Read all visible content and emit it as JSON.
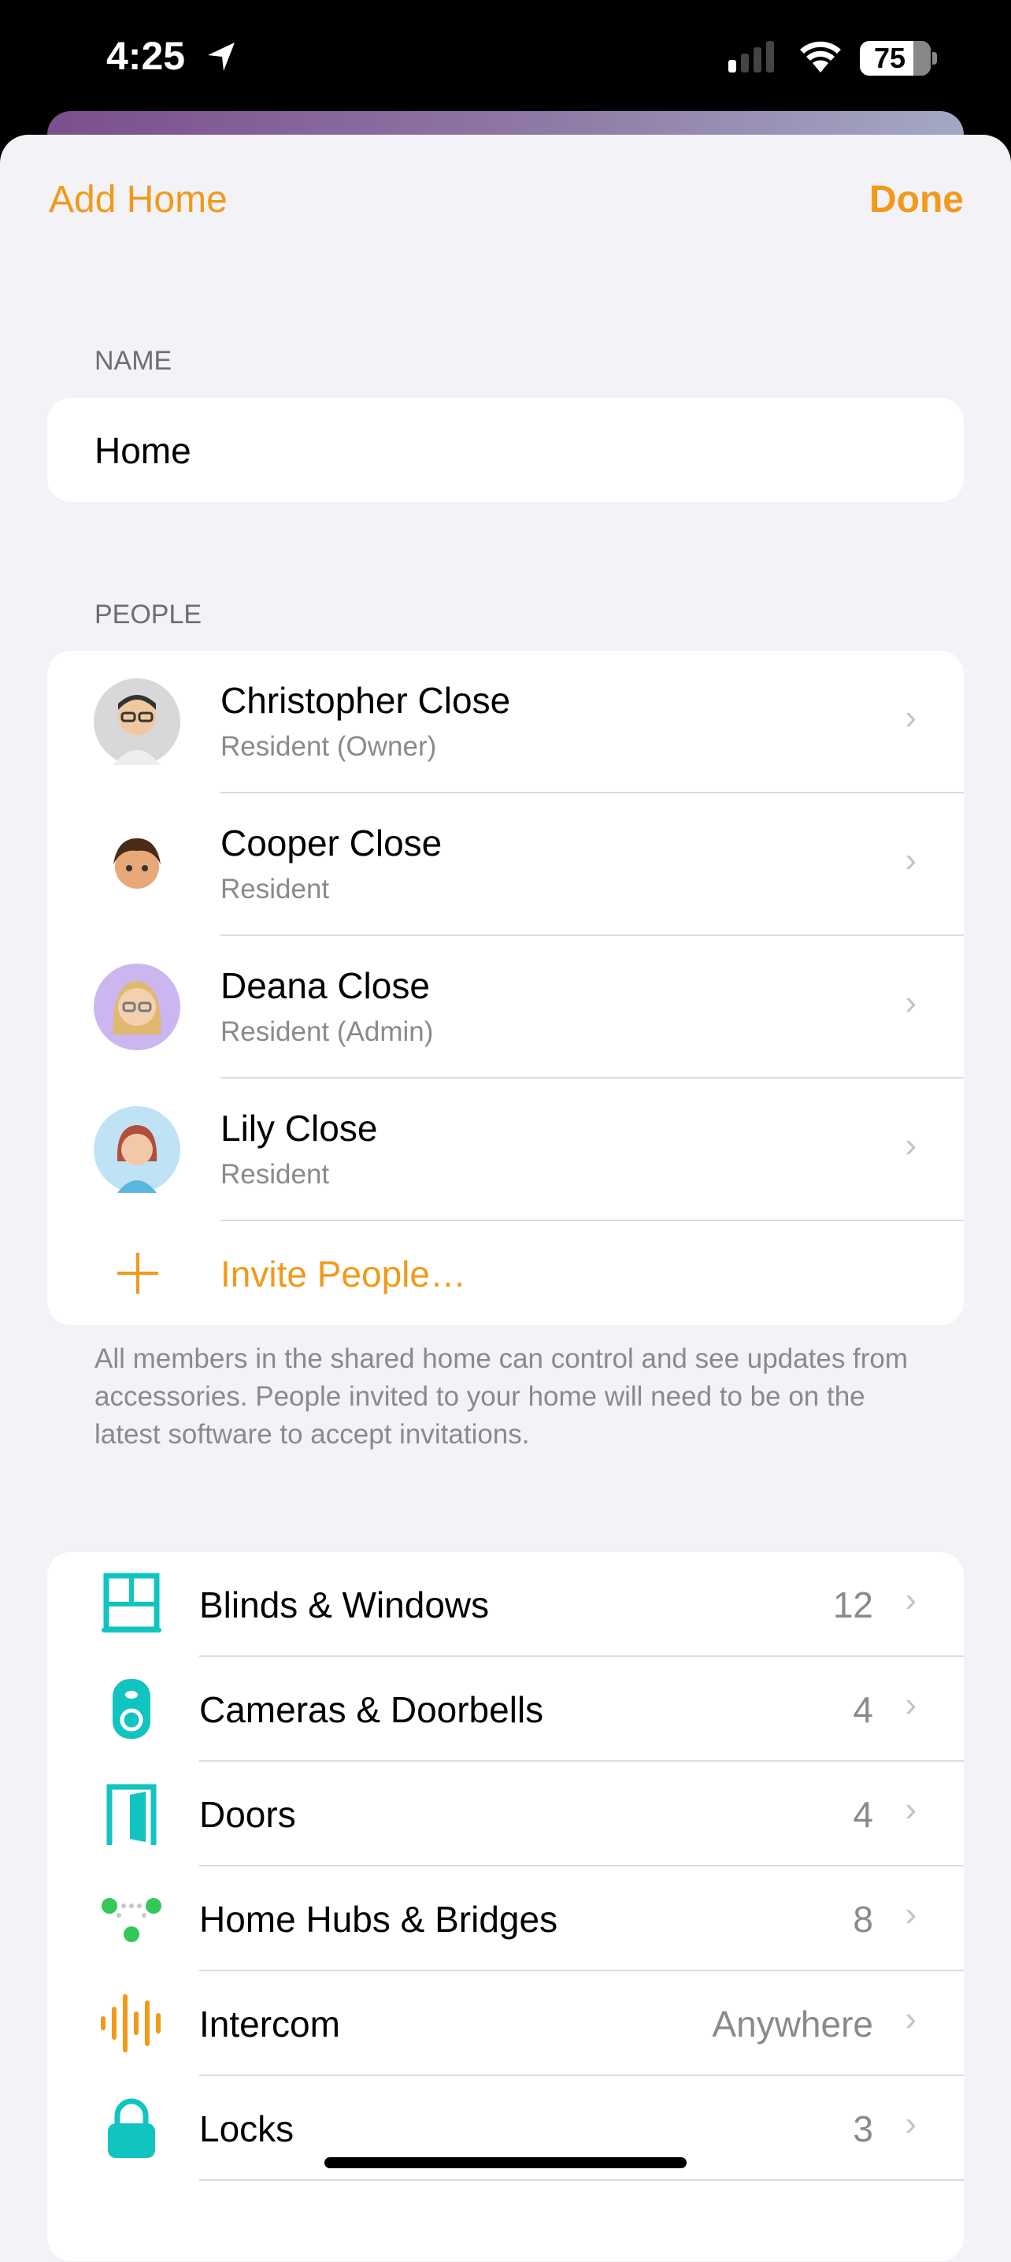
{
  "status_bar": {
    "time": "4:25",
    "battery": "75",
    "signal_bars": 1
  },
  "nav": {
    "left": "Add Home",
    "right": "Done"
  },
  "name_section": {
    "label": "NAME",
    "value": "Home"
  },
  "people_section": {
    "label": "PEOPLE",
    "people": [
      {
        "name": "Christopher Close",
        "role": "Resident (Owner)",
        "avatar_color": "#d8d8d8"
      },
      {
        "name": "Cooper Close",
        "role": "Resident",
        "avatar_color": "#ffffff"
      },
      {
        "name": "Deana Close",
        "role": "Resident (Admin)",
        "avatar_color": "#cbb6f0"
      },
      {
        "name": "Lily Close",
        "role": "Resident",
        "avatar_color": "#bfe3f5"
      }
    ],
    "invite": "Invite People…",
    "footer": "All members in the shared home can control and see updates from accessories. People invited to your home will need to be on the latest software to accept invitations."
  },
  "categories": [
    {
      "name": "Blinds & Windows",
      "value": "12",
      "icon": "window-blinds-icon"
    },
    {
      "name": "Cameras & Doorbells",
      "value": "4",
      "icon": "camera-doorbell-icon"
    },
    {
      "name": "Doors",
      "value": "4",
      "icon": "door-icon"
    },
    {
      "name": "Home Hubs & Bridges",
      "value": "8",
      "icon": "home-hub-icon"
    },
    {
      "name": "Intercom",
      "value": "Anywhere",
      "icon": "intercom-waveform-icon"
    },
    {
      "name": "Locks",
      "value": "3",
      "icon": "lock-icon"
    }
  ],
  "colors": {
    "accent": "#f19a1a",
    "teal": "#12c4bf",
    "green": "#34c759"
  }
}
